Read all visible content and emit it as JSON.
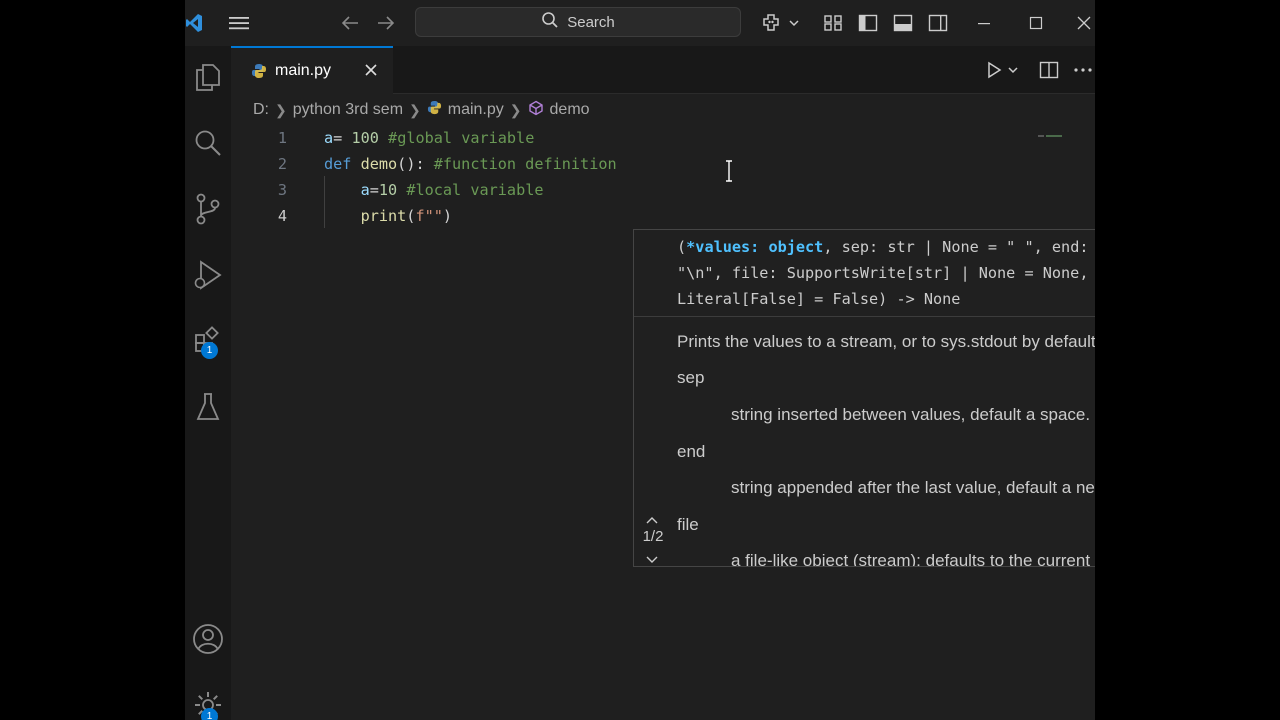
{
  "title_bar": {
    "search_label": "Search",
    "icons": [
      "vscode-logo-icon",
      "menu-icon",
      "back-arrow-icon",
      "forward-arrow-icon",
      "search-icon",
      "copilot-icon",
      "chevron-down-icon",
      "customize-layout-icon",
      "toggle-primary-sidebar-icon",
      "toggle-panel-icon",
      "toggle-secondary-sidebar-icon",
      "minimize-icon",
      "maximize-icon",
      "close-icon"
    ]
  },
  "activity_bar": {
    "items": [
      "explorer-icon",
      "search-icon",
      "source-control-icon",
      "run-debug-icon",
      "extensions-icon",
      "testing-icon",
      "accounts-icon",
      "manage-gear-icon"
    ],
    "extensions_badge": "1",
    "manage_badge": "1"
  },
  "tabs": [
    {
      "label": "main.py",
      "icon": "python-icon",
      "active": true
    }
  ],
  "breadcrumb": {
    "drive": "D:",
    "folder": "python 3rd sem",
    "file": "main.py",
    "symbol": "demo"
  },
  "editor": {
    "lines": [
      {
        "number": "1",
        "tokens": [
          {
            "t": "a",
            "c": "var"
          },
          {
            "t": "= ",
            "c": "pl"
          },
          {
            "t": "100",
            "c": "num"
          },
          {
            "t": " ",
            "c": "pl"
          },
          {
            "t": "#global variable",
            "c": "cm"
          }
        ]
      },
      {
        "number": "2",
        "tokens": [
          {
            "t": "def",
            "c": "kw"
          },
          {
            "t": " ",
            "c": "pl"
          },
          {
            "t": "demo",
            "c": "fn"
          },
          {
            "t": "(): ",
            "c": "pl"
          },
          {
            "t": "#function definition",
            "c": "cm"
          }
        ]
      },
      {
        "number": "3",
        "tokens": [
          {
            "t": "    ",
            "c": "pl"
          },
          {
            "t": "a",
            "c": "var"
          },
          {
            "t": "=",
            "c": "pl"
          },
          {
            "t": "10",
            "c": "num"
          },
          {
            "t": " ",
            "c": "pl"
          },
          {
            "t": "#local variable",
            "c": "cm"
          }
        ]
      },
      {
        "number": "4",
        "tokens": [
          {
            "t": "    ",
            "c": "pl"
          },
          {
            "t": "print",
            "c": "fn"
          },
          {
            "t": "(",
            "c": "pl"
          },
          {
            "t": "f\"\"",
            "c": "str"
          },
          {
            "t": ")",
            "c": "pl"
          }
        ]
      }
    ],
    "active_line": "4"
  },
  "hover": {
    "signature_param": "*values: object",
    "signature_rest": ", sep: str | None = \" \", end: str | None = \"\\n\", file: SupportsWrite[str] | None = None, flush: Literal[False] = False) -> None",
    "signature_open": "(",
    "description": "Prints the values to a stream, or to sys.stdout by default.",
    "params": [
      {
        "name": "sep",
        "desc": "string inserted between values, default a space."
      },
      {
        "name": "end",
        "desc": "string appended after the last value, default a newline."
      },
      {
        "name": "file",
        "desc": "a file-like object (stream); defaults to the current"
      }
    ],
    "overload": "1/2"
  },
  "colors": {
    "accent": "#0078d4",
    "editor_bg": "#1f1f1f",
    "sidebar_bg": "#181818"
  }
}
